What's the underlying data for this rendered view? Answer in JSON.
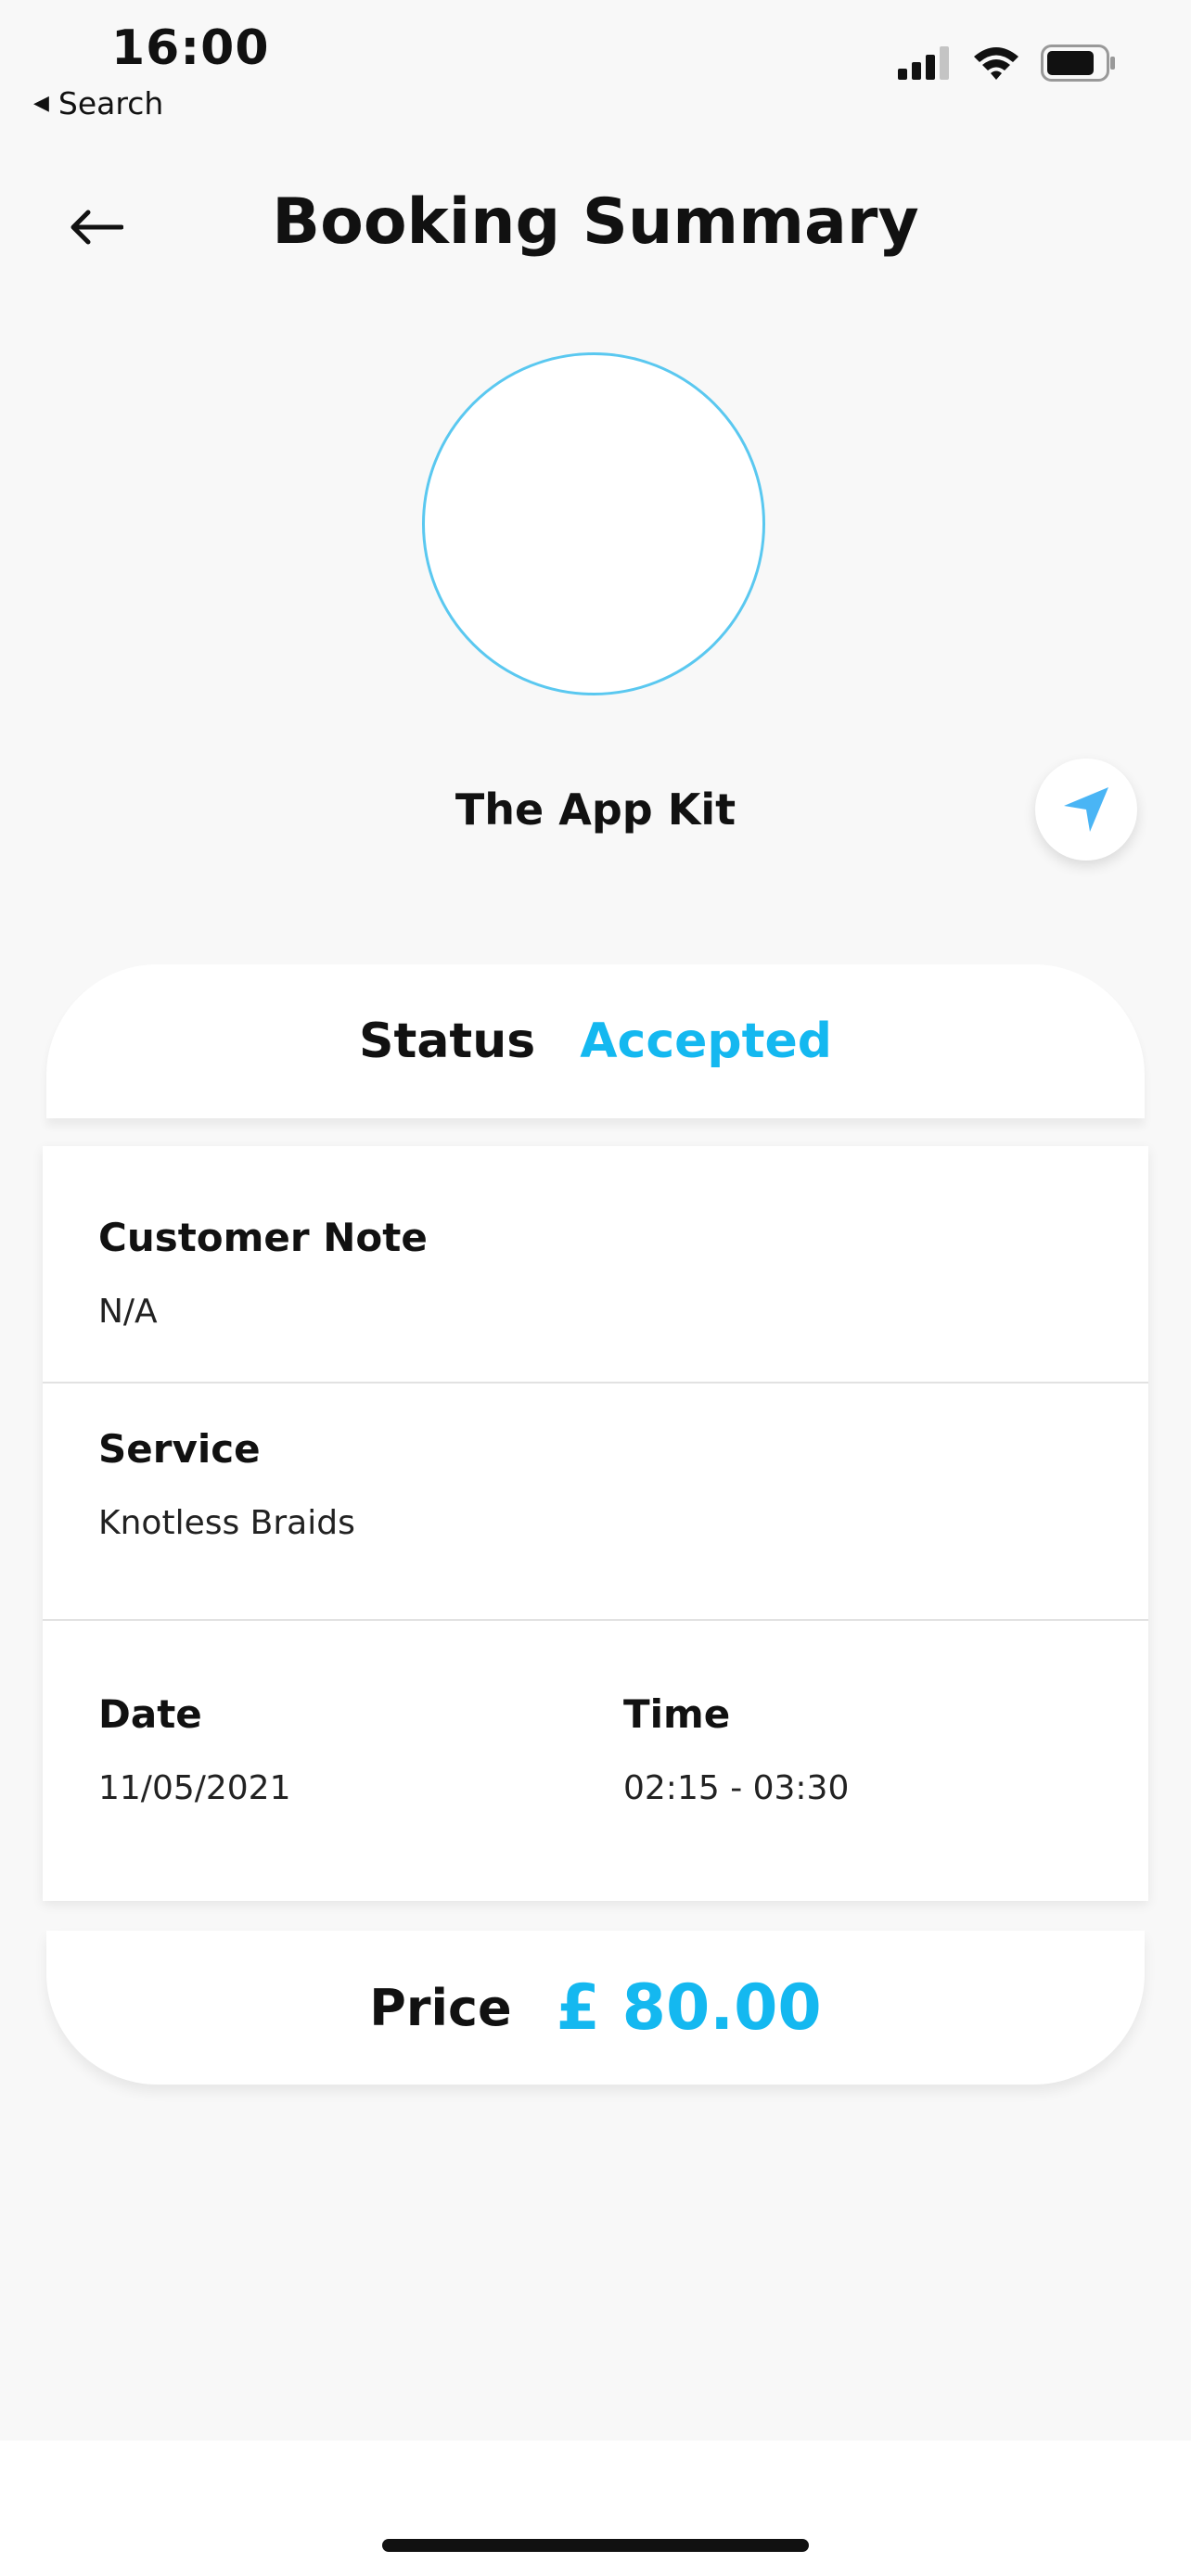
{
  "status_bar": {
    "time": "16:00",
    "back_app": "Search"
  },
  "header": {
    "title": "Booking Summary"
  },
  "business": {
    "name": "The App Kit"
  },
  "status": {
    "label": "Status",
    "value": "Accepted"
  },
  "details": {
    "customer_note_label": "Customer Note",
    "customer_note_value": "N/A",
    "service_label": "Service",
    "service_value": "Knotless Braids",
    "date_label": "Date",
    "date_value": "11/05/2021",
    "time_label": "Time",
    "time_value": "02:15 - 03:30"
  },
  "price": {
    "label": "Price",
    "value": "£ 80.00"
  },
  "colors": {
    "accent": "#14b8f0",
    "background": "#f8f8f8",
    "card": "#ffffff"
  },
  "icons": {
    "back": "back-arrow-icon",
    "navigate": "navigation-arrow-icon",
    "signal": "cellular-signal-icon",
    "wifi": "wifi-icon",
    "battery": "battery-icon"
  }
}
